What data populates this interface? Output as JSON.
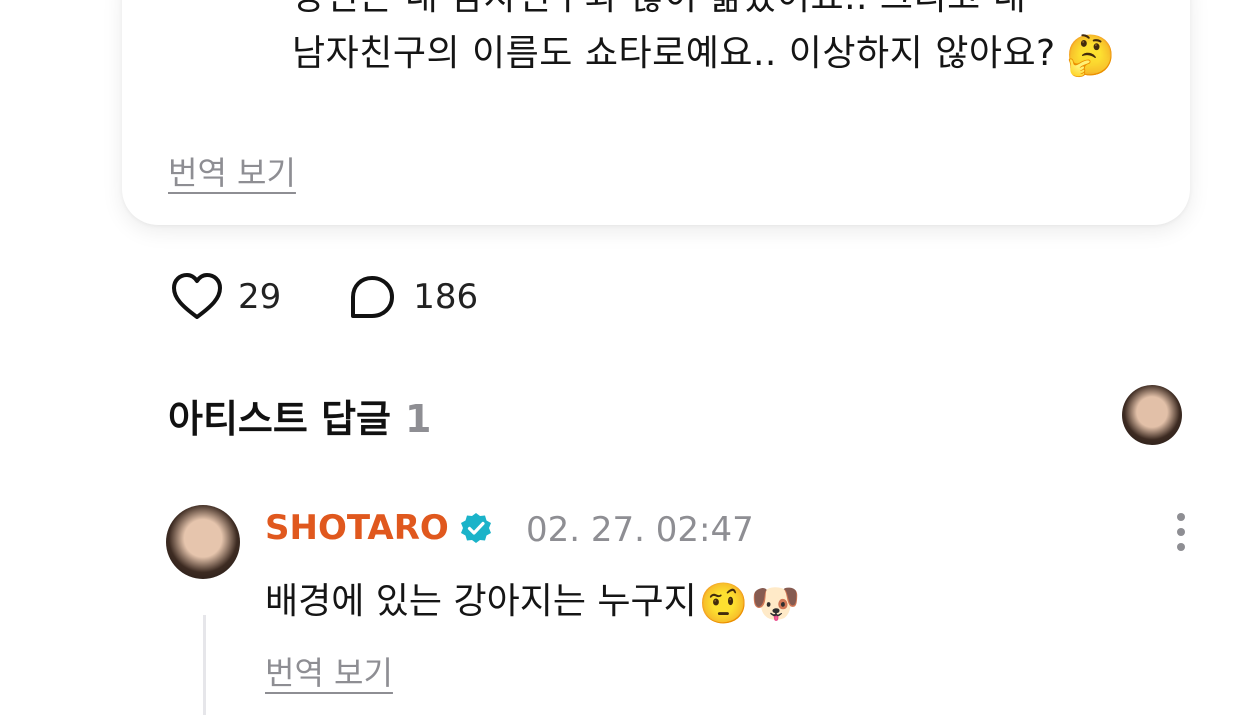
{
  "post": {
    "text_line1": "당신은 내 남자친구와 많이 닮았어요.. 그리고 내",
    "text_line2": "남자친구의 이름도 쇼타로예요.. 이상하지 않아요?",
    "emoji": "🤔",
    "translate_label": "번역 보기"
  },
  "actions": {
    "likes": "29",
    "comments": "186"
  },
  "artist_replies": {
    "title": "아티스트 답글",
    "count": "1"
  },
  "reply": {
    "author": "SHOTARO",
    "timestamp": "02. 27. 02:47",
    "text": "배경에 있는 강아지는 누구지",
    "emoji1": "🤨",
    "emoji2": "🐶",
    "translate_label": "번역 보기"
  },
  "colors": {
    "author_name": "#e0581e",
    "verified_badge": "#1bb3c9",
    "muted_text": "#8e8e93"
  },
  "icons": [
    "heart-icon",
    "comment-bubble-icon",
    "verified-badge-icon",
    "more-vertical-icon"
  ]
}
